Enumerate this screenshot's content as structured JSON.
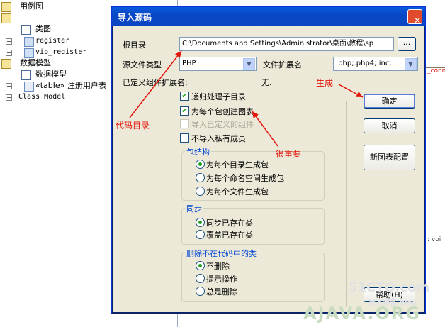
{
  "tree": {
    "items": [
      {
        "label": "用例图"
      },
      {
        "label": "类图"
      },
      {
        "label": "类图"
      },
      {
        "label": "register"
      },
      {
        "label": "vip_register"
      },
      {
        "label": "数据模型"
      },
      {
        "label": "数据模型"
      },
      {
        "label": "«table» 注册用户表"
      },
      {
        "label": "Class Model"
      }
    ]
  },
  "background": {
    "right_fragment_1": "_conn",
    "right_fragment_2": ": voi"
  },
  "dialog": {
    "title": "导入源码",
    "close_glyph": "✕",
    "root_dir_label": "根目录",
    "root_dir_value": "C:\\Documents and Settings\\Administrator\\桌面\\教程\\sp",
    "browse_label": "...",
    "src_type_label": "源文件类型",
    "src_type_value": "PHP",
    "ext_label": "文件扩展名",
    "ext_value": ".php;.php4;.inc;",
    "custom_ext_label": "已定义组件扩展名:",
    "custom_ext_value": "无.",
    "chk_recursive": "递归处理子目录",
    "chk_per_package": "为每个包创建图表",
    "chk_import_defined": "导入已定义的组件",
    "chk_no_private": "不导入私有成员",
    "pkg_group_title": "包结构",
    "pkg_opt1": "为每个目录生成包",
    "pkg_opt2": "为每个命名空间生成包",
    "pkg_opt3": "为每个文件生成包",
    "sync_group_title": "同步",
    "sync_opt1": "同步已存在类",
    "sync_opt2": "覆盖已存在类",
    "del_group_title": "删除不在代码中的类",
    "del_opt1": "不删除",
    "del_opt2": "提示操作",
    "del_opt3": "总是删除",
    "ok_label": "确定",
    "cancel_label": "取消",
    "new_diagram_label": "新图表配置",
    "help_label": "帮助(H)"
  },
  "annotations": {
    "code_dir": "代码目录",
    "important": "很重要",
    "generate": "生成"
  },
  "watermark": {
    "line1": "51CTO.com",
    "line2": "技术博客 Blog",
    "line3": "AJAVA.ORG"
  }
}
